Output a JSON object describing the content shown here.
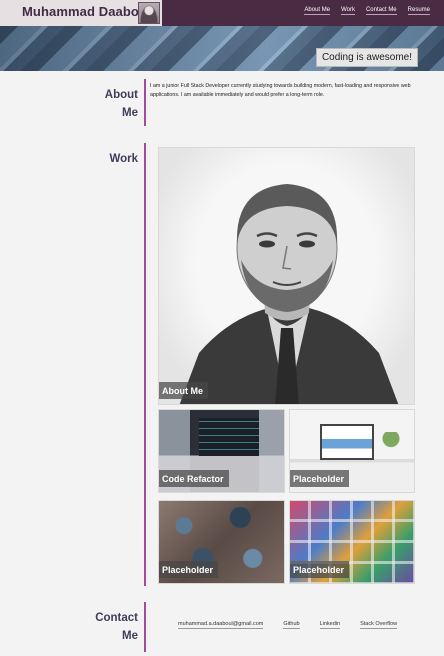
{
  "header": {
    "name": "Muhammad Daaboul",
    "nav": [
      "About Me",
      "Work",
      "Contact Me",
      "Resume"
    ]
  },
  "hero": {
    "tagline": "Coding is awesome!"
  },
  "about": {
    "title_line1": "About",
    "title_line2": "Me",
    "text": "I am a junior Full Stack Developer currently studying towards building modern, fast-loading and responsive web applications. I am available immediately and would prefer a long-term role."
  },
  "work": {
    "title": "Work",
    "tiles": [
      "About Me",
      "Code Refactor",
      "Placeholder",
      "Placeholder",
      "Placeholder"
    ]
  },
  "contact": {
    "title_line1": "Contact",
    "title_line2": "Me",
    "links": [
      "muhammad.a.daaboul@gmail.com",
      "Github",
      "Linkedin",
      "Stack Overflow"
    ]
  },
  "colors": {
    "header_bg": "#4a2b44",
    "accent": "#a24a9b",
    "heading": "#3e3d5a"
  }
}
